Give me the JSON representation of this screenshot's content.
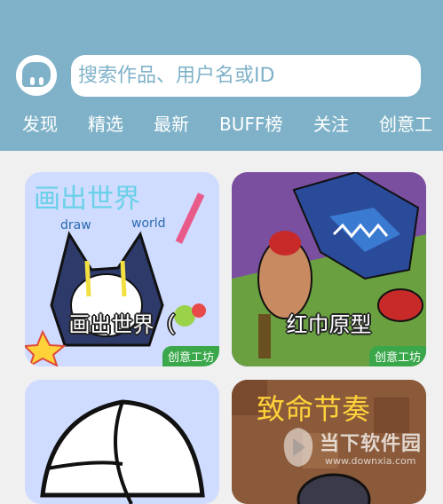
{
  "search": {
    "placeholder": "搜索作品、用户名或ID"
  },
  "tabs": [
    {
      "label": "发现"
    },
    {
      "label": "精选"
    },
    {
      "label": "最新"
    },
    {
      "label": "BUFF榜"
    },
    {
      "label": "关注"
    },
    {
      "label": "创意工"
    }
  ],
  "active_tab": "精选",
  "cards": [
    {
      "title": "画出世界（",
      "badge": "创意工坊",
      "art_text": [
        "画出世界",
        "draw",
        "world"
      ]
    },
    {
      "title": "红巾原型",
      "badge": "创意工坊"
    },
    {
      "title": ""
    },
    {
      "title": "",
      "art_text": [
        "致命节奏"
      ]
    }
  ],
  "watermark": {
    "main": "当下软件园",
    "sub": "www.downxia.com"
  },
  "colors": {
    "header": "#7fb2c8",
    "badge": "#3aa84a",
    "background": "#f0f0f0"
  }
}
